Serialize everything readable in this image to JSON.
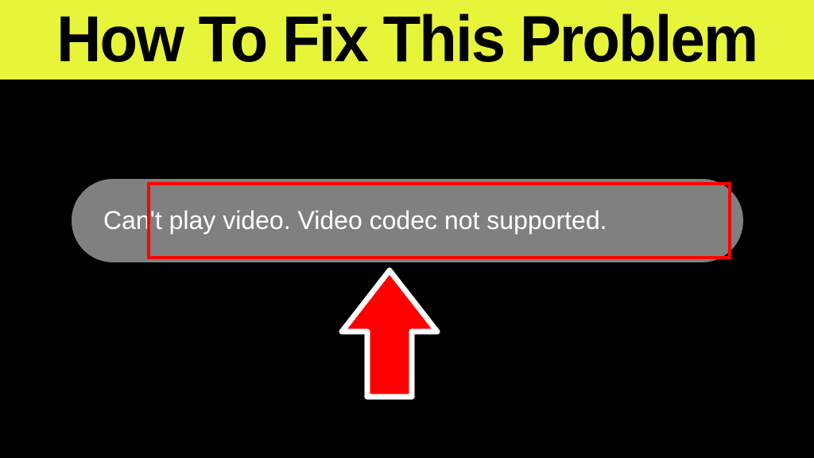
{
  "banner": {
    "title": "How To Fix This Problem",
    "background_color": "#e7f53a",
    "text_color": "#000000"
  },
  "toast": {
    "message": "Can't play video. Video codec not supported.",
    "background_color": "#808080",
    "text_color": "#ffffff",
    "highlight_color": "#ff0000"
  },
  "arrow": {
    "fill_color": "#ff0000",
    "stroke_color": "#ffffff"
  }
}
